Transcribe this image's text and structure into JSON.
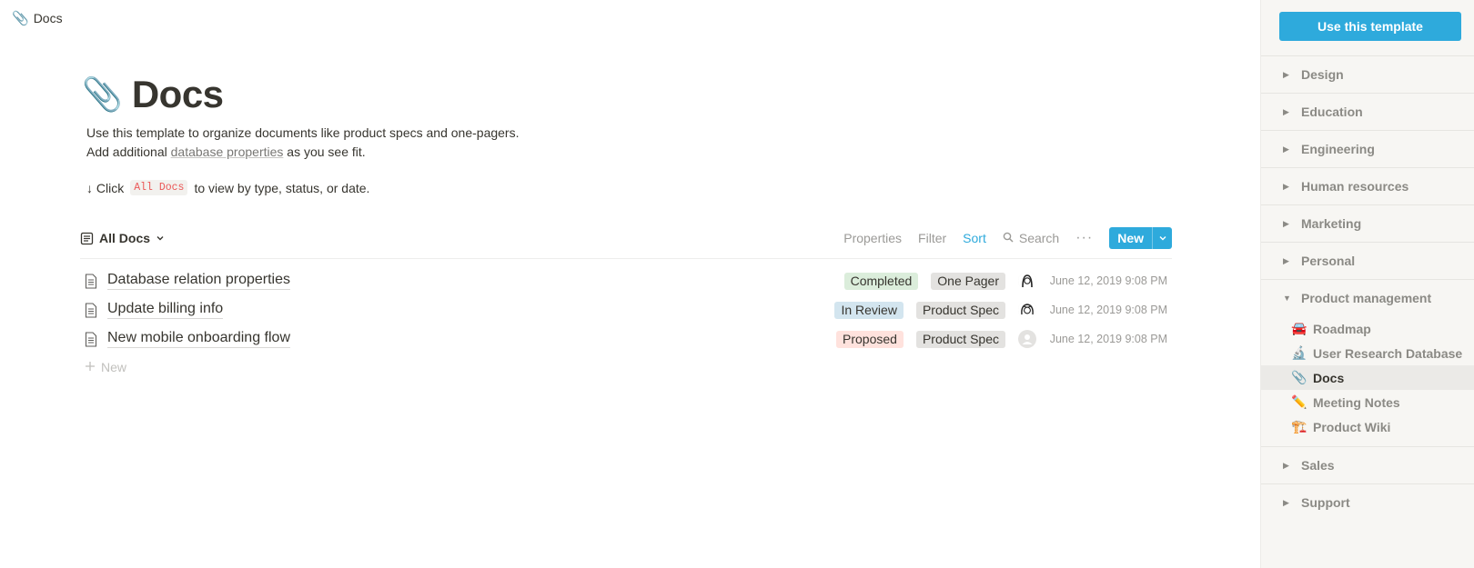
{
  "breadcrumb": {
    "emoji": "📎",
    "label": "Docs"
  },
  "page": {
    "emoji": "📎",
    "title": "Docs",
    "desc_line1": "Use this template to organize documents like product specs and one-pagers.",
    "desc_line2_prefix": "Add additional ",
    "desc_line2_link": "database properties",
    "desc_line2_suffix": " as you see fit.",
    "hint_prefix": "↓ Click",
    "hint_code": "All Docs",
    "hint_suffix": "to view by type, status, or date."
  },
  "toolbar": {
    "view_label": "All Docs",
    "properties": "Properties",
    "filter": "Filter",
    "sort": "Sort",
    "search": "Search",
    "more": "···",
    "new": "New"
  },
  "rows": [
    {
      "title": "Database relation properties",
      "status": "Completed",
      "status_bg": "#dbeddb",
      "tag": "One Pager",
      "date": "June 12, 2019 9:08 PM"
    },
    {
      "title": "Update billing info",
      "status": "In Review",
      "status_bg": "#d3e5ef",
      "tag": "Product Spec",
      "date": "June 12, 2019 9:08 PM"
    },
    {
      "title": "New mobile onboarding flow",
      "status": "Proposed",
      "status_bg": "#ffe2dd",
      "tag": "Product Spec",
      "date": "June 12, 2019 9:08 PM"
    }
  ],
  "add_new": "New",
  "sidebar": {
    "use_template": "Use this template",
    "categories": [
      {
        "label": "Design"
      },
      {
        "label": "Education"
      },
      {
        "label": "Engineering"
      },
      {
        "label": "Human resources"
      },
      {
        "label": "Marketing"
      },
      {
        "label": "Personal"
      },
      {
        "label": "Product management"
      },
      {
        "label": "Sales"
      },
      {
        "label": "Support"
      }
    ],
    "pm_items": [
      {
        "emoji": "🚘",
        "label": "Roadmap"
      },
      {
        "emoji": "🔬",
        "label": "User Research Database"
      },
      {
        "emoji": "📎",
        "label": "Docs"
      },
      {
        "emoji": "✏️",
        "label": "Meeting Notes"
      },
      {
        "emoji": "🏗️",
        "label": "Product Wiki"
      }
    ]
  }
}
